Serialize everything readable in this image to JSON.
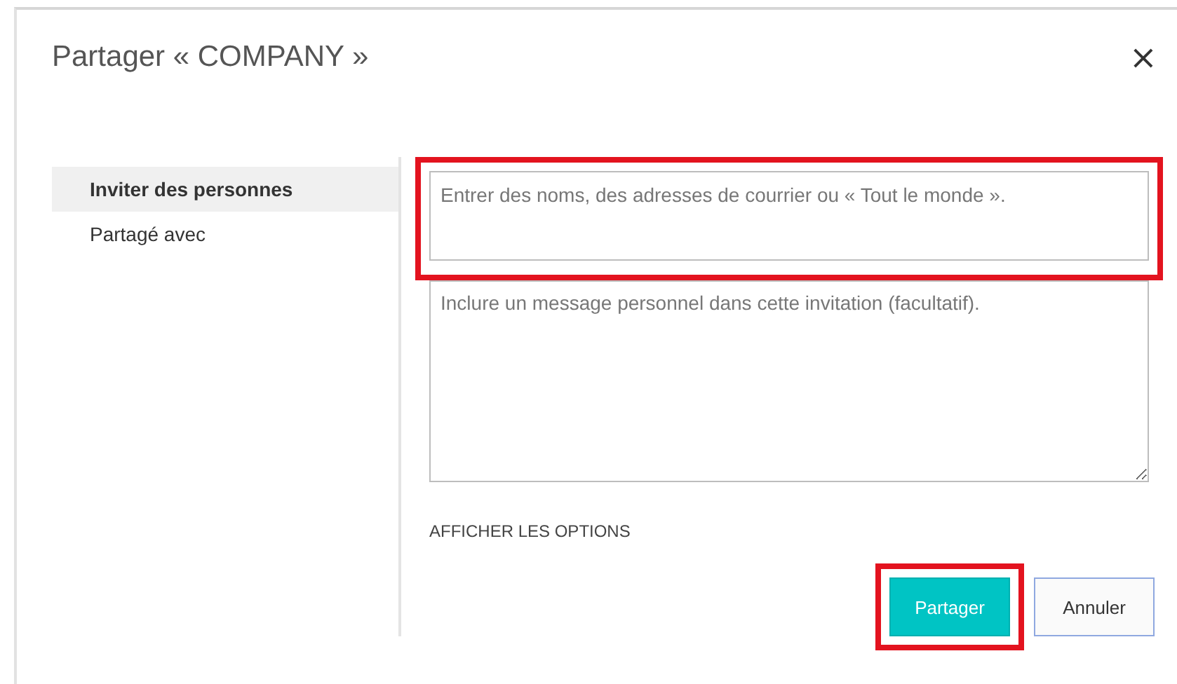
{
  "dialog": {
    "title": "Partager « COMPANY »",
    "close": "×"
  },
  "sidebar": {
    "items": [
      {
        "label": "Inviter des personnes",
        "selected": true
      },
      {
        "label": "Partagé avec",
        "selected": false
      }
    ]
  },
  "people_field": {
    "placeholder": "Entrer des noms, des adresses de courrier ou « Tout le monde ».",
    "highlighted": true
  },
  "message_field": {
    "placeholder": "Inclure un message personnel dans cette invitation (facultatif).",
    "highlighted": false
  },
  "options_link": "AFFICHER LES OPTIONS",
  "buttons": [
    {
      "label": "Partager",
      "kind": "primary",
      "highlighted": true
    },
    {
      "label": "Annuler",
      "kind": "secondary",
      "highlighted": false
    }
  ]
}
